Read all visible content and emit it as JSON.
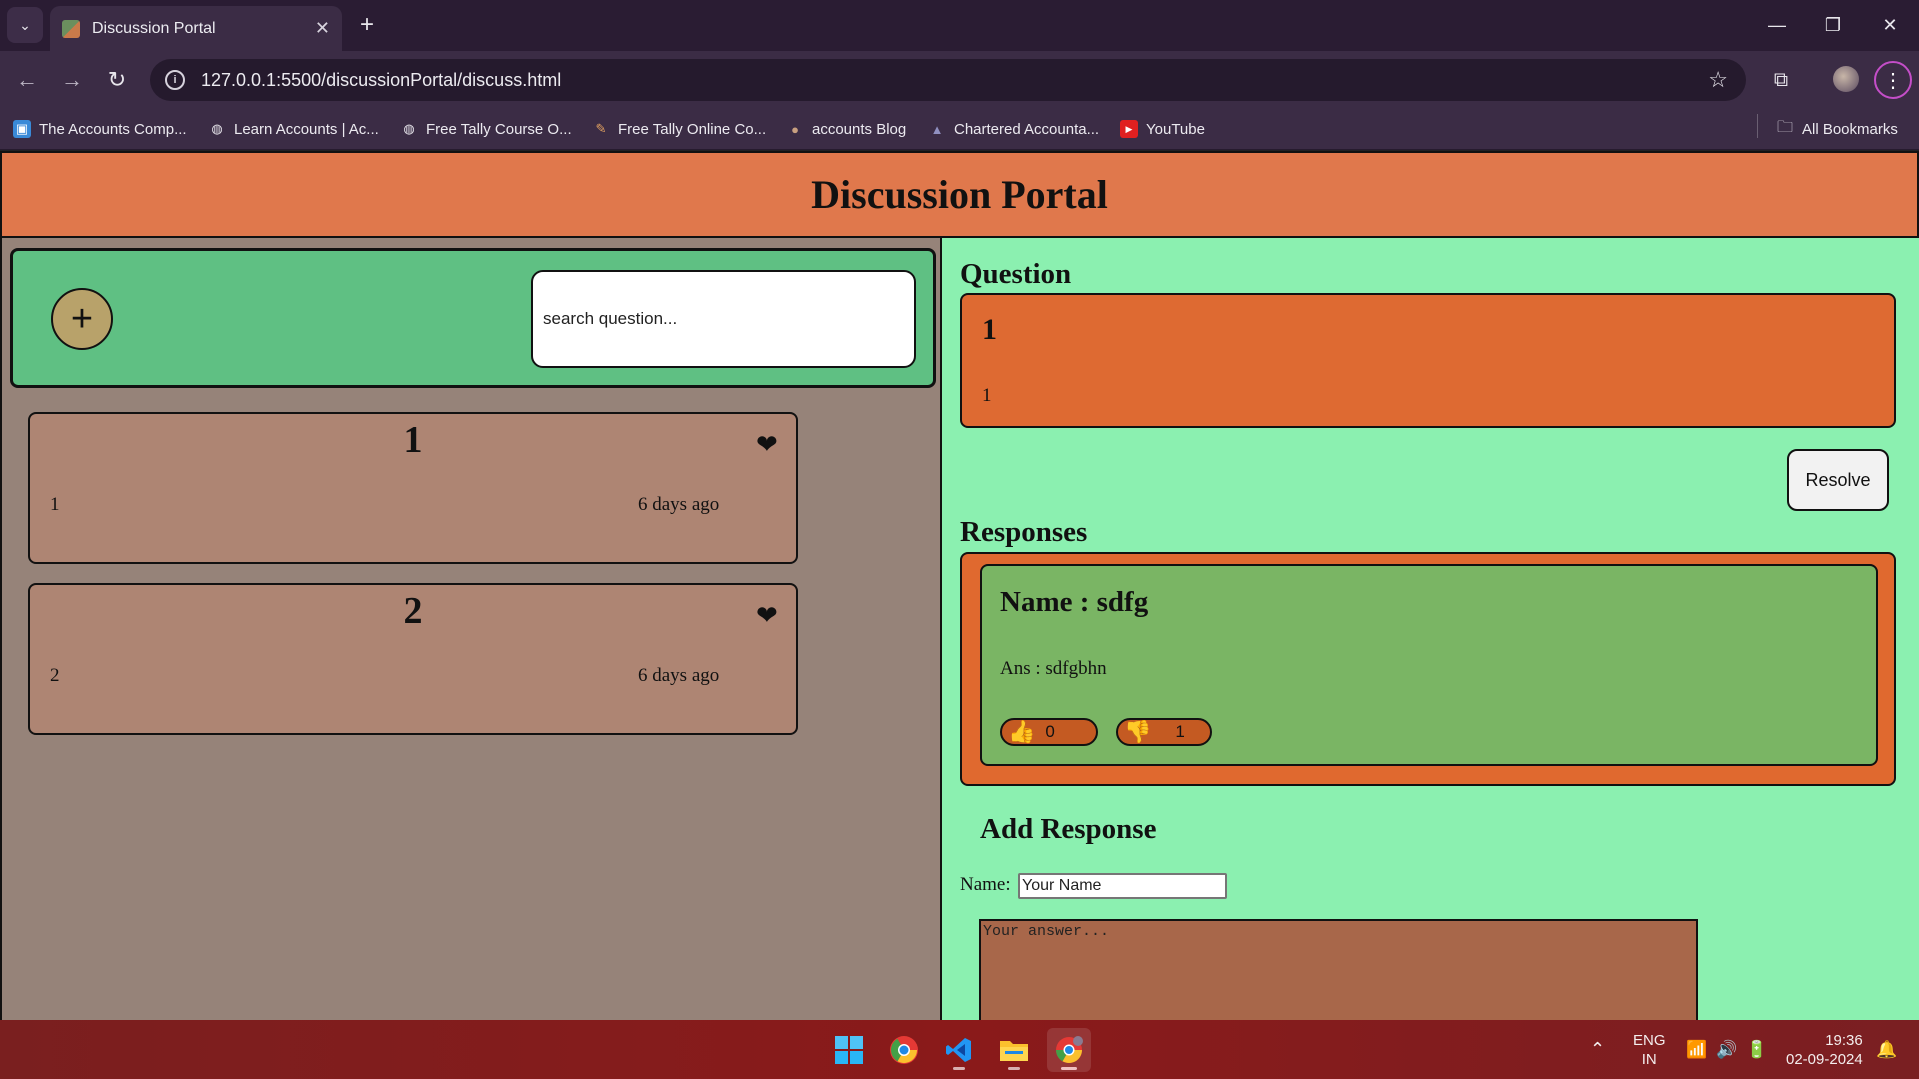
{
  "browser": {
    "tab_title": "Discussion Portal",
    "tab_close": "✕",
    "new_tab": "+",
    "url": "127.0.0.1:5500/discussionPortal/discuss.html",
    "bookmarks": [
      {
        "label": "The Accounts Comp...",
        "icon": "site-icon"
      },
      {
        "label": "Learn Accounts | Ac...",
        "icon": "globe-icon"
      },
      {
        "label": "Free Tally Course O...",
        "icon": "globe-icon"
      },
      {
        "label": "Free Tally Online Co...",
        "icon": "site-icon"
      },
      {
        "label": "accounts Blog",
        "icon": "site-icon"
      },
      {
        "label": "Chartered Accounta...",
        "icon": "site-icon"
      },
      {
        "label": "YouTube",
        "icon": "youtube-icon"
      }
    ],
    "all_bookmarks": "All Bookmarks"
  },
  "header": {
    "title": "Discussion Portal"
  },
  "sidebar": {
    "add_button": "+",
    "search_placeholder": "search question...",
    "questions": [
      {
        "title": "1",
        "description": "1",
        "time": "6 days ago"
      },
      {
        "title": "2",
        "description": "2",
        "time": "6 days ago"
      }
    ]
  },
  "detail": {
    "question_heading": "Question",
    "question": {
      "title": "1",
      "description": "1"
    },
    "resolve_label": "Resolve",
    "responses_heading": "Responses",
    "responses": [
      {
        "name": "Name : sdfg",
        "answer": "Ans : sdfgbhn",
        "likes": "0",
        "dislikes": "1"
      }
    ],
    "add_response_heading": "Add Response",
    "name_label": "Name:",
    "name_placeholder": "Your Name",
    "answer_placeholder": "Your answer..."
  },
  "taskbar": {
    "lang_top": "ENG",
    "lang_bottom": "IN",
    "time": "19:36",
    "date": "02-09-2024"
  },
  "colors": {
    "header_bg": "#e0784c",
    "right_bg": "#8bf0b0",
    "left_bg": "#968379",
    "card_bg": "#ae8573"
  }
}
